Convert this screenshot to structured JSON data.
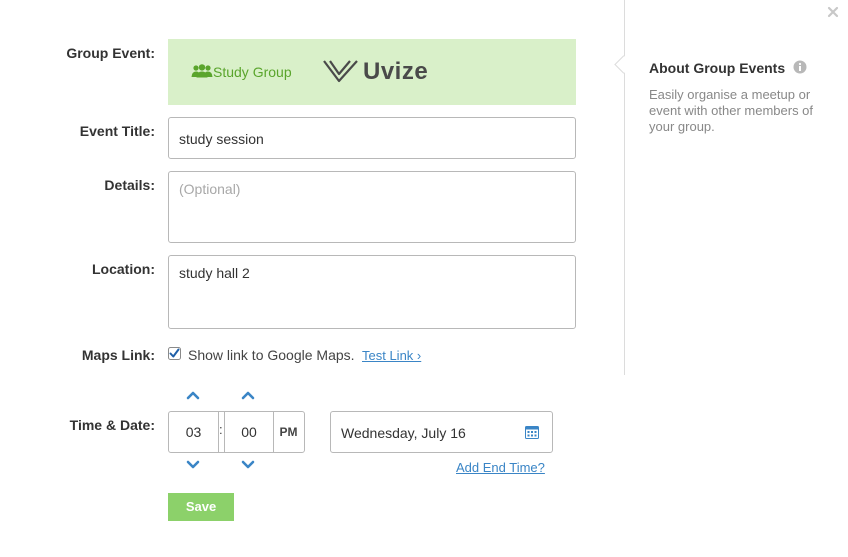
{
  "close_icon": "close-icon",
  "form": {
    "group_event": {
      "label": "Group Event:",
      "group_name": "Study Group",
      "brand_name": "Uvize",
      "group_icon": "users-icon",
      "banner_color": "#d9f0c9"
    },
    "event_title": {
      "label": "Event Title:",
      "value": "study session"
    },
    "details": {
      "label": "Details:",
      "value": "",
      "placeholder": "(Optional)"
    },
    "location": {
      "label": "Location:",
      "value": "study hall 2"
    },
    "maps_link": {
      "label": "Maps Link:",
      "checked": true,
      "text": "Show link to Google Maps.",
      "test_link": "Test Link ›"
    },
    "time_date": {
      "label": "Time & Date:",
      "hour": "03",
      "separator": ":",
      "minute": "00",
      "ampm": "PM",
      "date": "Wednesday, July 16",
      "calendar_icon": "calendar-icon",
      "add_end_time": "Add End Time?"
    },
    "save_label": "Save"
  },
  "sidebar": {
    "title": "About Group Events",
    "info_icon": "info-icon",
    "description": "Easily organise a meetup or event with other members of your group."
  },
  "colors": {
    "accent_green": "#8cd16a",
    "link_blue": "#3a85c6",
    "group_green": "#5aa52c"
  }
}
